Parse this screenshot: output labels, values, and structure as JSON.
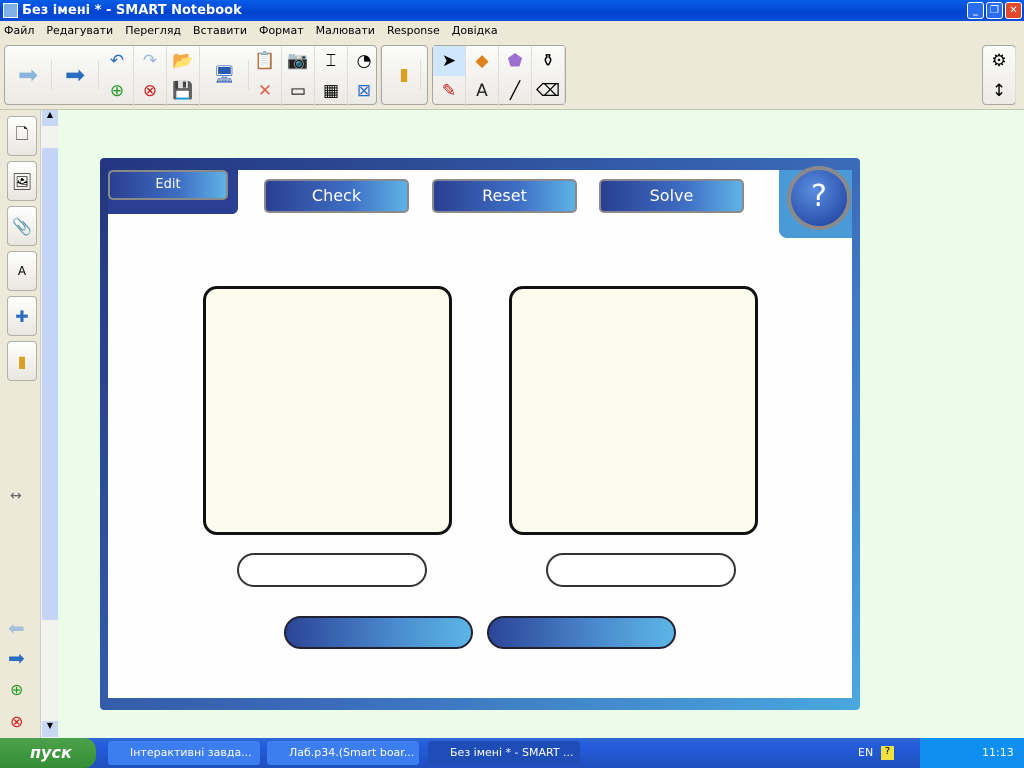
{
  "window": {
    "title": "Без імені * - SMART Notebook"
  },
  "menu": [
    "Файл",
    "Редагувати",
    "Перегляд",
    "Вставити",
    "Формат",
    "Малювати",
    "Response",
    "Довідка"
  ],
  "widget": {
    "edit": "Edit",
    "check": "Check",
    "reset": "Reset",
    "solve": "Solve",
    "help": "?"
  },
  "taskbar": {
    "start": "пуск",
    "tasks": [
      "Інтерактивні завда...",
      "Лаб.р34.(Smart boar...",
      "Без імені * - SMART ..."
    ],
    "lang": "EN",
    "time": "11:13"
  },
  "colors": {
    "canvas": "#ebfde8",
    "frame": "#2a3f92",
    "accent": "#5eb3e8"
  }
}
